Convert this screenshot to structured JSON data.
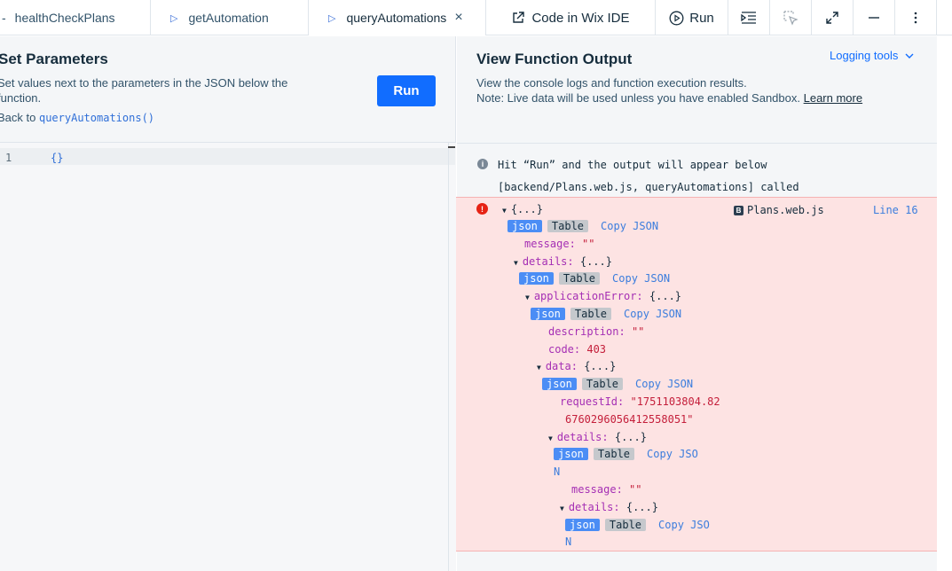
{
  "tabs": [
    {
      "label": "healthCheckPlans",
      "prefix": "-"
    },
    {
      "label": "getAutomation",
      "icon": "play-icon"
    },
    {
      "label": "queryAutomations",
      "icon": "play-icon",
      "active": true,
      "close": "×"
    }
  ],
  "toolbar": {
    "code_in_ide_label": "Code in Wix IDE",
    "run_label": "Run"
  },
  "left": {
    "title": "Set Parameters",
    "description": "Set values next to the parameters in the JSON below the function.",
    "back_prefix": "Back to",
    "back_fn": "queryAutomations()",
    "run_button": "Run",
    "editor": {
      "line_number": "1",
      "code": "{}"
    }
  },
  "right": {
    "title": "View Function Output",
    "logging_tools": "Logging tools",
    "description_line1": "View the console logs and function execution results.",
    "description_line2": "Note: Live data will be used unless you have enabled Sandbox.",
    "learn_more": "Learn more",
    "info_message": "Hit “Run” and the output will appear below",
    "call_message": "[backend/Plans.web.js, queryAutomations] called",
    "error": {
      "file": "Plans.web.js",
      "line": "Line 16",
      "root": "{...}",
      "badge_json": "json",
      "badge_table": "Table",
      "copy_json": "Copy JSON",
      "copy_json_wrap_a": "Copy JSO",
      "copy_json_wrap_b": "N",
      "message_key": "message:",
      "message_val": "\"\"",
      "details_key": "details:",
      "collapsed": "{...}",
      "application_error_key": "applicationError:",
      "description_key": "description:",
      "description_val": "\"\"",
      "code_key": "code:",
      "code_val": "403",
      "data_key": "data:",
      "request_id_key": "requestId:",
      "request_id_line1": "\"1751103804.82",
      "request_id_line2": "6760296056412558051\""
    }
  }
}
